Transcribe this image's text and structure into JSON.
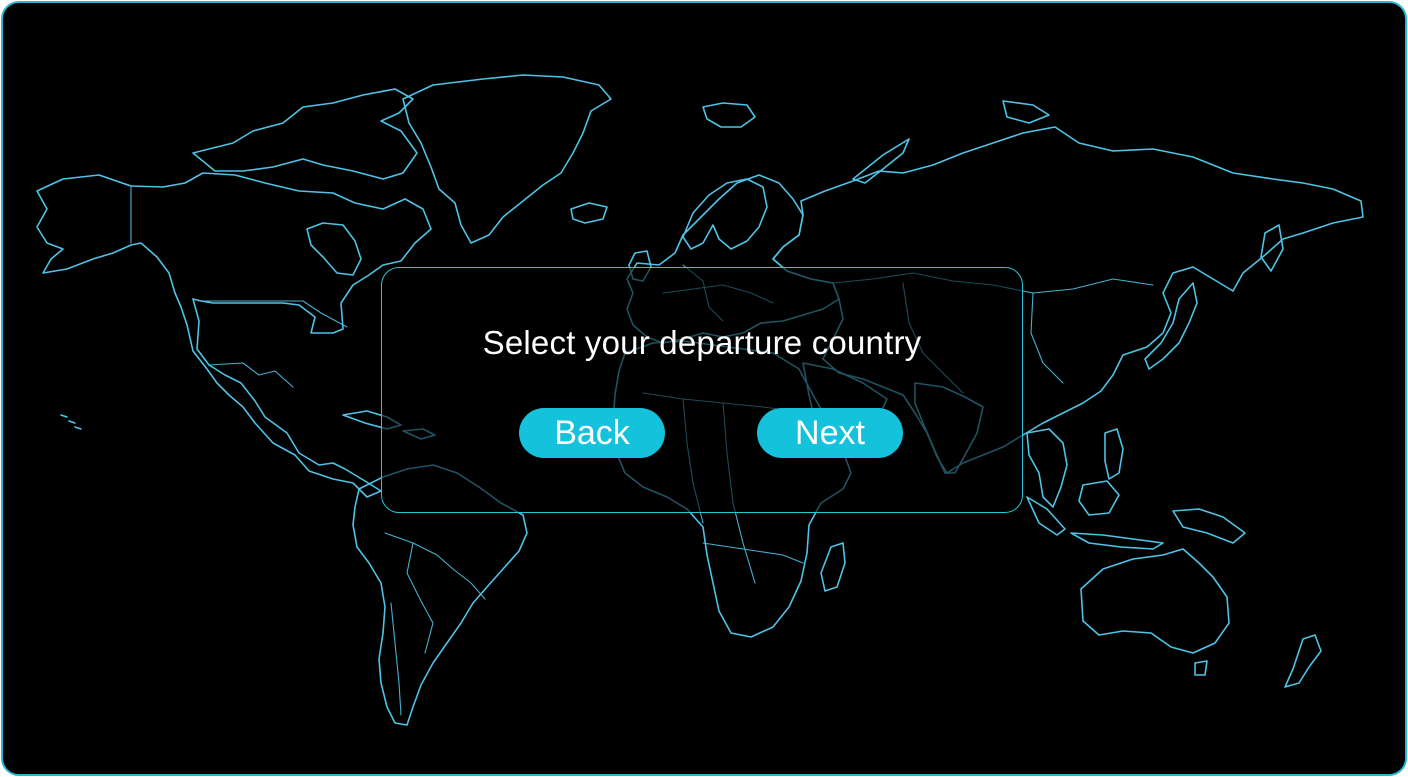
{
  "dialog": {
    "title": "Select your departure country",
    "back_label": "Back",
    "next_label": "Next"
  },
  "colors": {
    "background": "#000000",
    "map_outline": "#4fc3e6",
    "accent": "#14c2dc",
    "dialog_border": "#2cc3dc",
    "text": "#ffffff"
  },
  "icons": {
    "background_map": "world-map"
  }
}
